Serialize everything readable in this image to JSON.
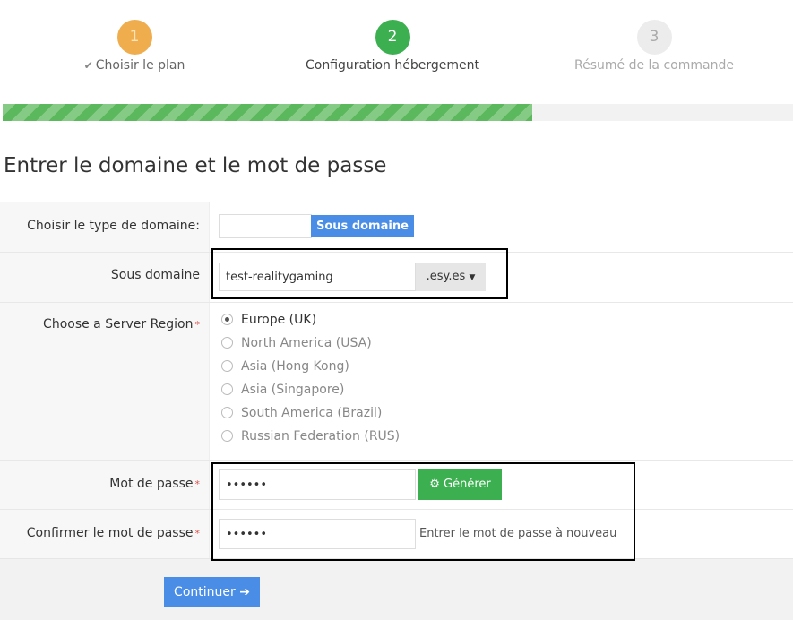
{
  "steps": [
    {
      "number": "1",
      "label": "Choisir le plan"
    },
    {
      "number": "2",
      "label": "Configuration hébergement"
    },
    {
      "number": "3",
      "label": "Résumé de la commande"
    }
  ],
  "progress": {
    "percent": 67
  },
  "page_title": "Entrer le domaine et le mot de passe",
  "domain_type": {
    "label": "Choisir le type de domaine:",
    "button_label": "Sous domaine",
    "input_value": ""
  },
  "subdomain": {
    "label": "Sous domaine",
    "value": "test-realitygaming",
    "suffix": ".esy.es"
  },
  "region": {
    "label": "Choose a Server Region",
    "required": "*",
    "options": [
      {
        "label": "Europe (UK)",
        "selected": true
      },
      {
        "label": "North America (USA)",
        "selected": false
      },
      {
        "label": "Asia (Hong Kong)",
        "selected": false
      },
      {
        "label": "Asia (Singapore)",
        "selected": false
      },
      {
        "label": "South America (Brazil)",
        "selected": false
      },
      {
        "label": "Russian Federation (RUS)",
        "selected": false
      }
    ]
  },
  "password": {
    "label": "Mot de passe",
    "required": "*",
    "value": "••••••",
    "generate_label": "Générer"
  },
  "confirm_password": {
    "label": "Confirmer le mot de passe",
    "required": "*",
    "value": "••••••",
    "hint": "Entrer le mot de passe à nouveau"
  },
  "continue_label": "Continuer",
  "colors": {
    "accent": "#4a8de6",
    "success": "#3cb050",
    "warning": "#f0ad4e"
  },
  "icons": {
    "check": "check-icon",
    "gear": "gear-icon",
    "arrow": "arrow-circle-right-icon",
    "caret": "caret-down-icon"
  }
}
